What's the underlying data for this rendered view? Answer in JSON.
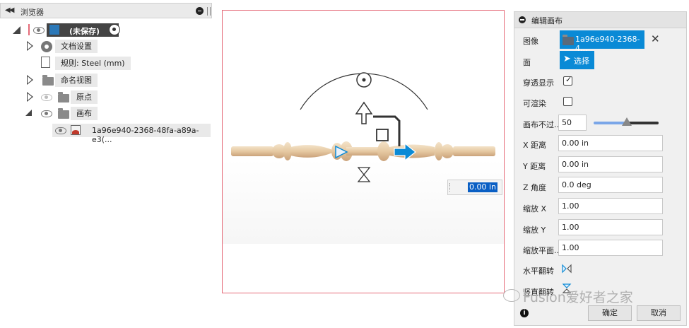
{
  "browser": {
    "header_title": "浏览器",
    "root": {
      "label": "(未保存)"
    },
    "items": [
      {
        "label": "文档设置"
      },
      {
        "label": "规则: Steel (mm)"
      },
      {
        "label": "命名视图"
      },
      {
        "label": "原点"
      },
      {
        "label": "画布"
      },
      {
        "label": "1a96e940-2368-48fa-a89a-e3(..."
      }
    ]
  },
  "viewport": {
    "value_input": "0.00 in"
  },
  "dialog": {
    "title": "编辑画布",
    "image_label": "图像",
    "image_value": "1a96e940-2368-4...",
    "face_label": "面",
    "face_button": "选择",
    "see_through_label": "穿透显示",
    "renderable_label": "可渲染",
    "opacity_label": "画布不过...",
    "opacity_value": "50",
    "x_label": "X 距离",
    "x_value": "0.00 in",
    "y_label": "Y 距离",
    "y_value": "0.00 in",
    "z_label": "Z 角度",
    "z_value": "0.0 deg",
    "scale_x_label": "缩放 X",
    "scale_x_value": "1.00",
    "scale_y_label": "缩放 Y",
    "scale_y_value": "1.00",
    "scale_plane_label": "缩放平面...",
    "scale_plane_value": "1.00",
    "flip_h_label": "水平翻转",
    "flip_v_label": "竖直翻转",
    "ok": "确定",
    "cancel": "取消"
  },
  "watermark": "Fusion爱好者之家",
  "colors": {
    "accent": "#0a8ad6",
    "viewport_border": "#e56a78",
    "wood": "#e8cfae"
  }
}
